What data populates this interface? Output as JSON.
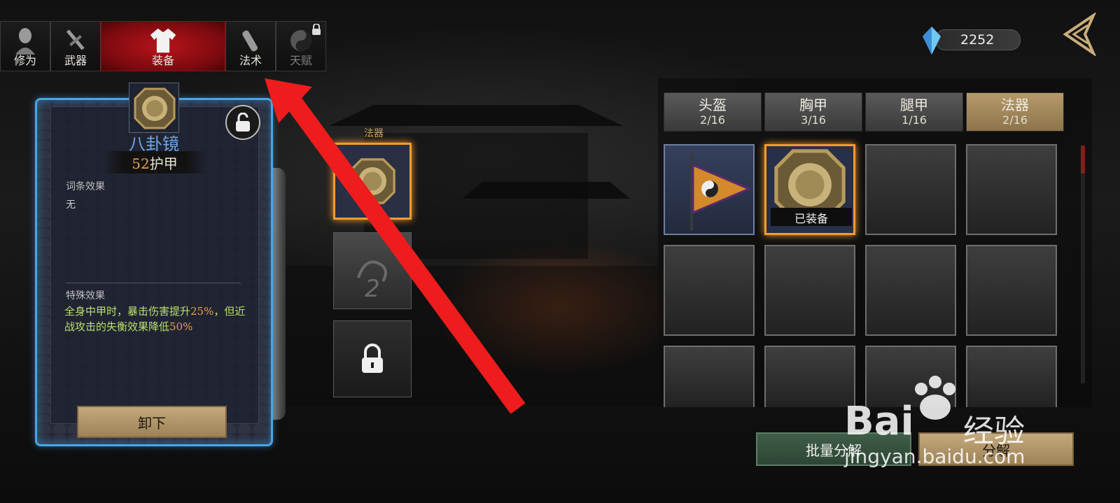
{
  "nav": {
    "tabs": [
      {
        "label": "修为",
        "icon": "cultivation-icon",
        "active": false,
        "locked": false
      },
      {
        "label": "武器",
        "icon": "weapon-icon",
        "active": false,
        "locked": false
      },
      {
        "label": "装备",
        "icon": "robe-icon",
        "active": true,
        "locked": false
      },
      {
        "label": "法术",
        "icon": "spell-icon",
        "active": false,
        "locked": false
      },
      {
        "label": "天赋",
        "icon": "taiji-icon",
        "active": false,
        "locked": true
      }
    ]
  },
  "currency": {
    "value": "2252",
    "icon": "crystal-icon"
  },
  "detail": {
    "name": "八卦镜",
    "armor_value": "52",
    "armor_unit": "护甲",
    "affix_title": "词条效果",
    "affix_text": "无",
    "special_title": "特殊效果",
    "special_parts": [
      "全身中甲时，暴击伤害提升",
      "25%",
      "，但近战攻击的失衡效果降低",
      "50%"
    ],
    "unequip_label": "卸下"
  },
  "slots": {
    "title": "法器",
    "second_slot_number": "2"
  },
  "inventory": {
    "tabs": [
      {
        "name": "头盔",
        "count": "2/16",
        "active": false
      },
      {
        "name": "胸甲",
        "count": "3/16",
        "active": false
      },
      {
        "name": "腿甲",
        "count": "1/16",
        "active": false
      },
      {
        "name": "法器",
        "count": "2/16",
        "active": true
      }
    ],
    "equipped_tag": "已装备",
    "batch_label": "批量分解",
    "decompose_label": "分解"
  },
  "watermark": {
    "brand": "Bai",
    "brand_suffix": "经验",
    "url": "jingyan.baidu.com"
  },
  "colors": {
    "accent_orange": "#f39b2e",
    "frame_blue": "#48a6e8",
    "active_red": "#b8141a",
    "special_green": "#b9e06a"
  }
}
